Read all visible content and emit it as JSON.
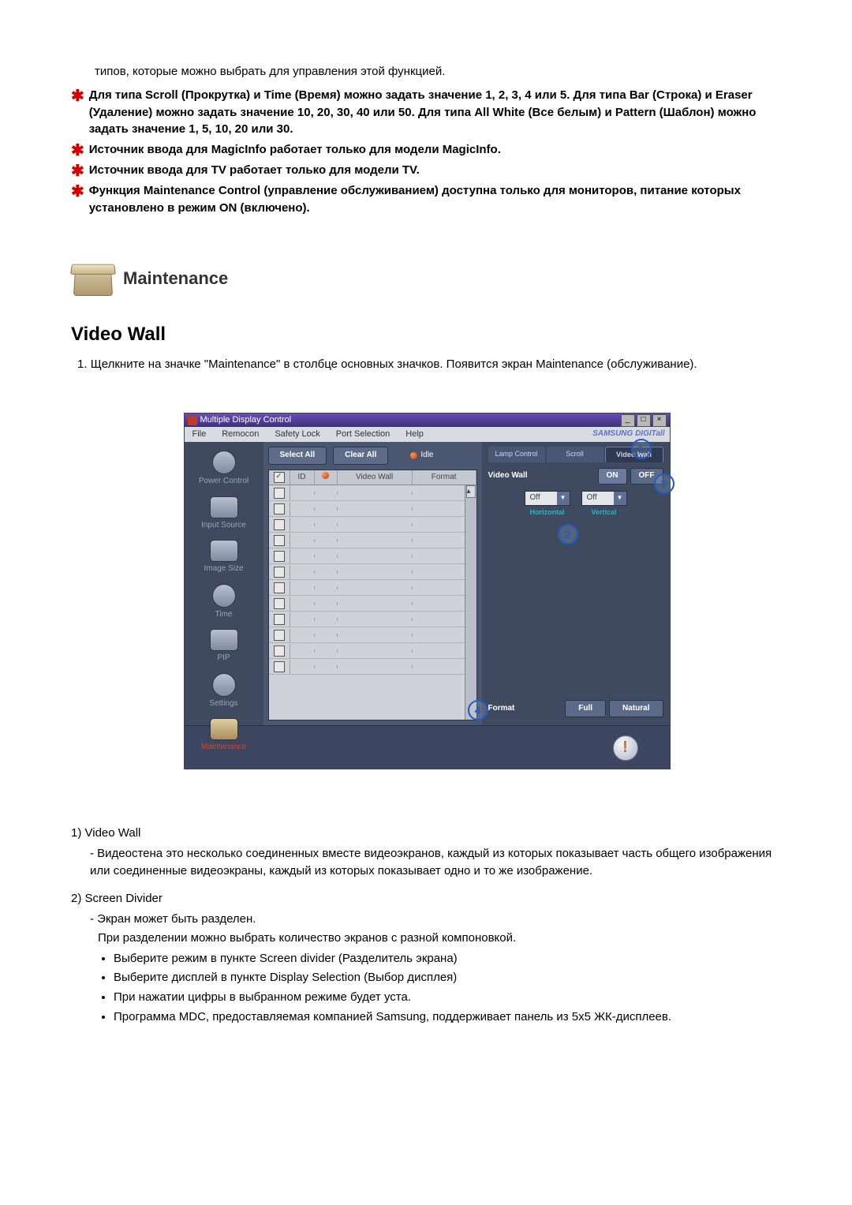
{
  "intro": "типов, которые можно выбрать для управления этой функцией.",
  "notes": [
    "Для типа Scroll (Прокрутка) и Time (Время) можно задать значение 1, 2, 3, 4 или 5. Для типа Bar (Строка) и Eraser (Удаление) можно задать значение 10, 20, 30, 40 или 50. Для типа All White (Все белым) и Pattern (Шаблон) можно задать значение 1, 5, 10, 20 или 30.",
    "Источник ввода для MagicInfo работает только для модели MagicInfo.",
    "Источник ввода для TV работает только для модели TV.",
    "Функция Maintenance Control (управление обслуживанием) доступна только для мониторов, питание которых установлено в режим ON (включено)."
  ],
  "section": {
    "title": "Maintenance",
    "subsection": "Video Wall",
    "step1_num": "1.",
    "step1_text": "Щелкните на значке \"Maintenance\" в столбце основных значков. Появится экран Maintenance (обслуживание)."
  },
  "app": {
    "title": "Multiple Display Control",
    "menus": [
      "File",
      "Remocon",
      "Safety Lock",
      "Port Selection",
      "Help"
    ],
    "brand": "SAMSUNG DIGITall",
    "sidebar": [
      {
        "label": "Power Control"
      },
      {
        "label": "Input Source"
      },
      {
        "label": "Image Size"
      },
      {
        "label": "Time"
      },
      {
        "label": "PIP"
      },
      {
        "label": "Settings"
      },
      {
        "label": "Maintenance",
        "active": true
      }
    ],
    "actions": {
      "select_all": "Select All",
      "clear_all": "Clear All",
      "idle": "Idle"
    },
    "table": {
      "headers": {
        "id": "ID",
        "video_wall": "Video Wall",
        "format": "Format"
      },
      "rows": 12
    },
    "right": {
      "tabs": [
        "Lamp Control",
        "Scroll",
        "Video Wall"
      ],
      "active_tab": 2,
      "videoWallLabel": "Video Wall",
      "on": "ON",
      "off": "OFF",
      "horizontal": {
        "value": "Off",
        "label": "Horizontal"
      },
      "vertical": {
        "value": "Off",
        "label": "Vertical"
      },
      "formatLabel": "Format",
      "format_full": "Full",
      "format_natural": "Natural"
    },
    "callouts": {
      "c1": "1",
      "c2": "2",
      "c3": "3",
      "c4": "4"
    }
  },
  "below": {
    "n1": "1)",
    "n1_title": "Video Wall",
    "n1_dash": "- Видеостена это несколько соединенных вместе видеоэкранов, каждый из которых показывает часть общего изображения или соединенные видеоэкраны, каждый из которых показывает одно и то же изображение.",
    "n2": "2)",
    "n2_title": "Screen Divider",
    "n2_dash1": "- Экран может быть разделен.",
    "n2_dash1b": "При разделении можно выбрать количество экранов с разной компоновкой.",
    "bullets": [
      "Выберите режим в пункте Screen divider (Разделитель экрана)",
      "Выберите дисплей в пункте Display Selection (Выбор дисплея)",
      "При нажатии цифры в выбранном режиме будет уста.",
      "Программа MDC, предоставляемая компанией Samsung, поддерживает панель из 5x5 ЖК-дисплеев."
    ]
  }
}
